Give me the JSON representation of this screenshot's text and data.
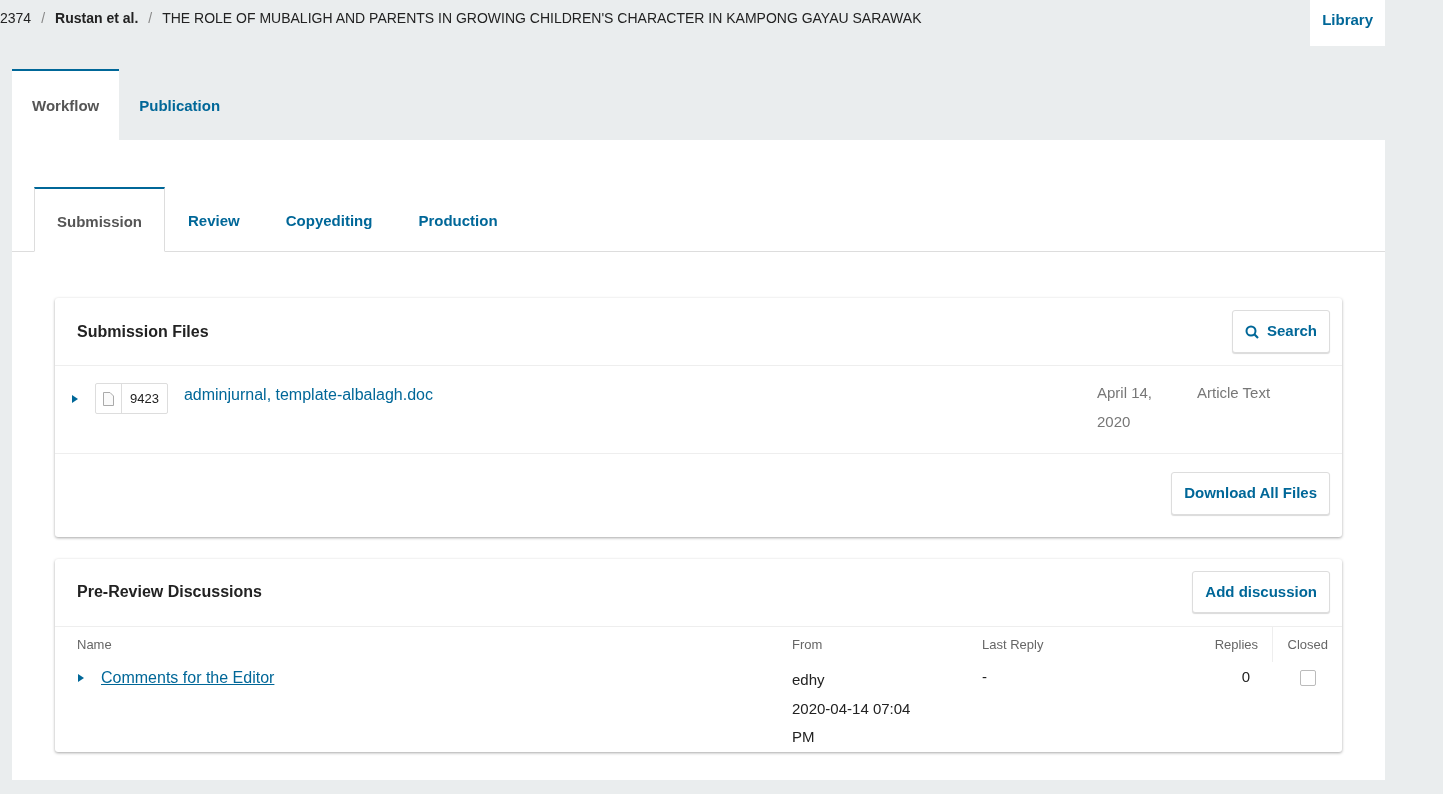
{
  "breadcrumb": {
    "id": "2374",
    "separator": "/",
    "authors": "Rustan et al.",
    "title": "THE ROLE OF MUBALIGH AND PARENTS IN GROWING CHILDREN'S CHARACTER IN KAMPONG GAYAU SARAWAK"
  },
  "library_button": "Library",
  "main_tabs": [
    {
      "label": "Workflow",
      "selected": true
    },
    {
      "label": "Publication",
      "selected": false
    }
  ],
  "stage_tabs": [
    {
      "label": "Submission",
      "selected": true
    },
    {
      "label": "Review",
      "selected": false
    },
    {
      "label": "Copyediting",
      "selected": false
    },
    {
      "label": "Production",
      "selected": false
    }
  ],
  "submission_files": {
    "title": "Submission Files",
    "search_button": "Search",
    "files": [
      {
        "expanded": false,
        "file_id": "9423",
        "name": "adminjurnal, template-albalagh.doc",
        "date": "April 14, 2020",
        "type": "Article Text"
      }
    ],
    "download_button": "Download All Files"
  },
  "discussions": {
    "title": "Pre-Review Discussions",
    "add_button": "Add discussion",
    "columns": [
      "Name",
      "From",
      "Last Reply",
      "Replies",
      "Closed"
    ],
    "rows": [
      {
        "expanded": false,
        "name": "Comments for the Editor",
        "from": "edhy",
        "from_date": "2020-04-14 07:04 PM",
        "last_reply": "-",
        "replies": "0",
        "closed": false
      }
    ]
  }
}
